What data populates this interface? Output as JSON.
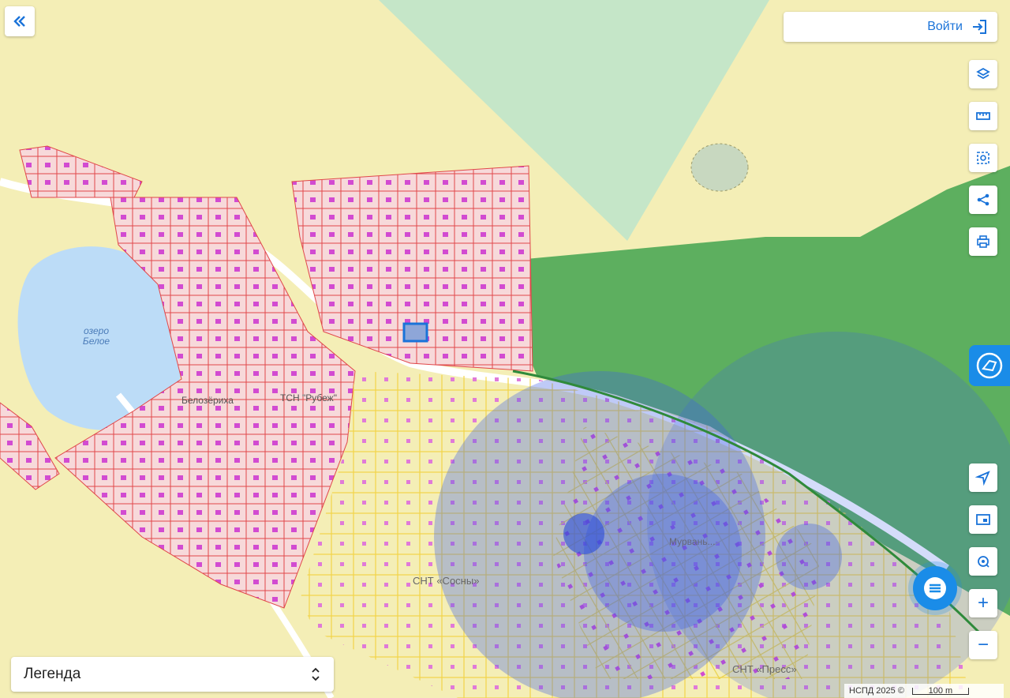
{
  "header": {
    "login_label": "Войти"
  },
  "map": {
    "labels": {
      "lake": "озеро\nБелое",
      "village": "Белозёриха",
      "tsn": "ТСН \"Рубеж\"",
      "snt_sosny": "СНТ «Сосны»",
      "snt_press": "СНТ «Пресс»",
      "smol": "Мурвань..."
    },
    "colors": {
      "land": "#f4eeb6",
      "forest_light": "#c5e6c8",
      "forest_dark": "#5daf5f",
      "lake": "#bcdcf7",
      "parcel_red_fill": "#f7d9da",
      "parcel_red_stroke": "#e0474a",
      "parcel_yellow_stroke": "#f2d447",
      "building": "#d24bd1",
      "circle_blue": "#3c5ee6",
      "selected": "#1a73d9"
    }
  },
  "legend": {
    "label": "Легенда"
  },
  "attribution": {
    "text": "НСПД 2025 ©",
    "scale_label": "100 m"
  },
  "toolbar": {
    "layers": "layers-icon",
    "ruler": "ruler-icon",
    "select": "select-area-icon",
    "share": "share-icon",
    "print": "print-icon",
    "locate": "locate-icon",
    "minimap": "minimap-icon",
    "search_point": "point-search-icon",
    "zoom_in": "+",
    "zoom_out": "−"
  }
}
